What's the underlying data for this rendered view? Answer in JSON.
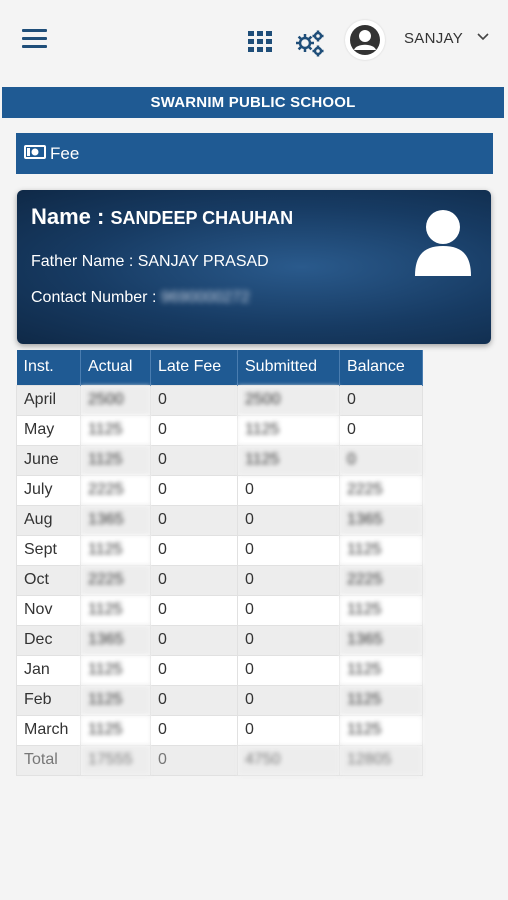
{
  "header": {
    "menu_icon": "hamburger-icon",
    "apps_icon": "grid-apps-icon",
    "settings_icon": "gears-icon",
    "avatar_icon": "user-avatar-icon",
    "user_name": "SANJAY",
    "dropdown_icon": "chevron-down-icon"
  },
  "school": {
    "name": "SWARNIM PUBLIC SCHOOL"
  },
  "section": {
    "icon": "money-icon",
    "title": "Fee"
  },
  "student": {
    "name_label": "Name : ",
    "name": "SANDEEP CHAUHAN",
    "father_label": "Father Name : ",
    "father": "SANJAY PRASAD",
    "contact_label": "Contact Number : ",
    "contact": "9690000272"
  },
  "colors": {
    "primary": "#1f5a93",
    "card_dark": "#0f2947"
  },
  "table": {
    "headers": [
      "Inst.",
      "Actual",
      "Late Fee",
      "Submitted",
      "Balance"
    ],
    "rows": [
      [
        "April",
        "2500",
        "0",
        "2500",
        "0"
      ],
      [
        "May",
        "1125",
        "0",
        "1125",
        "0"
      ],
      [
        "June",
        "1125",
        "0",
        "1125",
        "0"
      ],
      [
        "July",
        "2225",
        "0",
        "0",
        "2225"
      ],
      [
        "Aug",
        "1365",
        "0",
        "0",
        "1365"
      ],
      [
        "Sept",
        "1125",
        "0",
        "0",
        "1125"
      ],
      [
        "Oct",
        "2225",
        "0",
        "0",
        "2225"
      ],
      [
        "Nov",
        "1125",
        "0",
        "0",
        "1125"
      ],
      [
        "Dec",
        "1365",
        "0",
        "0",
        "1365"
      ],
      [
        "Jan",
        "1125",
        "0",
        "0",
        "1125"
      ],
      [
        "Feb",
        "1125",
        "0",
        "0",
        "1125"
      ],
      [
        "March",
        "1125",
        "0",
        "0",
        "1125"
      ],
      [
        "Total",
        "17555",
        "0",
        "4750",
        "12805"
      ]
    ]
  }
}
